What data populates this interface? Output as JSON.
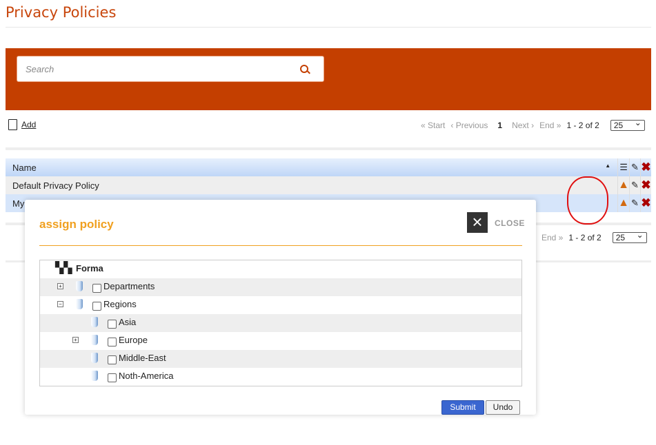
{
  "page": {
    "title": "Privacy Policies"
  },
  "search": {
    "placeholder": "Search"
  },
  "toolbar": {
    "add_label": "Add"
  },
  "pager": {
    "start": "« Start",
    "previous": "‹ Previous",
    "current": "1",
    "next": "Next ›",
    "end": "End »",
    "range": "1 - 2 of 2",
    "page_size": "25"
  },
  "table": {
    "header": "Name",
    "rows": [
      {
        "name": "Default Privacy Policy"
      },
      {
        "name": "My"
      }
    ]
  },
  "modal": {
    "title": "assign policy",
    "close_label": "CLOSE",
    "root": "Forma",
    "nodes": [
      {
        "label": "Departments",
        "expander": "+"
      },
      {
        "label": "Regions",
        "expander": "−"
      },
      {
        "label": "Asia"
      },
      {
        "label": "Europe",
        "expander": "+"
      },
      {
        "label": "Middle-East"
      },
      {
        "label": "Noth-America"
      }
    ],
    "submit": "Submit",
    "undo": "Undo"
  },
  "colors": {
    "brand": "#c43f00",
    "accent": "#f0a020",
    "delete": "#aa0000",
    "warning": "#d2690e",
    "annotation": "#e01010"
  }
}
